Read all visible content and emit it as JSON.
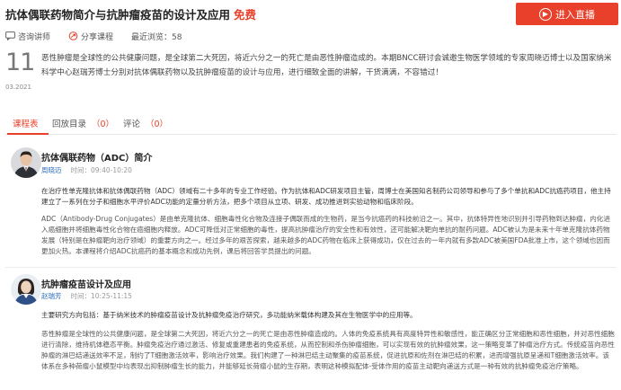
{
  "header": {
    "title": "抗体偶联药物简介与抗肿瘤疫苗的设计及应用",
    "free_label": "免费",
    "live_button": "进入直播"
  },
  "meta": {
    "consult": "咨询讲师",
    "share": "分享课程",
    "views": "最近浏览：58"
  },
  "date": {
    "day": "11",
    "month_year": "03.2021"
  },
  "intro": "恶性肿瘤是全球性的公共健康问题，是全球第二大死因，将近六分之一的死亡是由恶性肿瘤造成的。本期BNCC研讨会诚邀生物医学领域的专家周晓迈博士以及国家纳米科学中心赵瑞芳博士分别对抗体偶联药物以及抗肿瘤疫苗的设计与应用，进行细致全面的讲解，干货满满，不容错过！",
  "tabs": [
    {
      "label": "课程表",
      "count": ""
    },
    {
      "label": "回放目录",
      "count": "（0）"
    },
    {
      "label": "评论",
      "count": "（0）"
    }
  ],
  "courses": [
    {
      "title": "抗体偶联药物（ADC）简介",
      "speaker": "周晓迈",
      "time": "时间：09:40-10:20",
      "paragraphs": [
        "在治疗性单克隆抗体和抗体偶联药物（ADC）领域有二十多年的专业工作经验。作为抗体和ADC研发项目主管，周博士在美国知名制药公司领导和参与了多个单抗和ADC抗癌药项目，他主持建立了一系列在分子和细胞水平评价ADC功能的定量分析方法，把多个项目从立项、研发、成功推进到实验动物和临床阶段。",
        "ADC（Antibody-Drug Conjugates）是由单克隆抗体、细胞毒性化合物及连接子偶联而成的生物药，是当今抗癌药的科技前沿之一。其中，抗体特异性地识别并引导药物到达肿瘤，内化进入癌细胞并将细胞毒性化合物在癌细胞内释放。ADC可降低对正常细胞的毒性，提高抗肿瘤治疗的安全性和有效性，还可能解决靶向单抗的耐药问题。ADC被认为是未来十年单克隆抗体药物发展（特别是在肿瘤靶向治疗领域）的重要方向之一。经过多年的艰苦探索，越来越多的ADC药物在临床上获得成功，仅在过去的一年内就有多款ADC被美国FDA批准上市，这个领域也因而更加火热。本课程将介绍ADC抗癌药的基本概念和成功先例，课后将回答学员提出的问题。"
      ]
    },
    {
      "title": "抗肿瘤疫苗设计及应用",
      "speaker": "赵瑞芳",
      "time": "时间：10:25-11:15",
      "paragraphs": [
        "主要研究方向包括：基于纳米技术的肿瘤疫苗设计及抗肿瘤免疫治疗研究，多功能纳米载体构建及其在生物医学中的应用等。",
        "恶性肿瘤是全球性的公共健康问题，是全球第二大死因，将近六分之一的死亡是由恶性肿瘤造成的。人体的免疫系统具有高度特异性和敏感性，能正确区分正常细胞和恶性细胞，并对恶性细胞进行清除，维持机体稳态平衡。肿瘤免疫治疗通过激活、修复或重建患者的免疫系统，从而控制和杀伤肿瘤细胞，可以实现有效的抗肿瘤效果，这一策略变革了肿瘤治疗方式。传统疫苗向恶性肿瘤的淋巴结递送效率不足，制约了T细胞激活效率，影响治疗效果。我们构建了一种淋巴结主动聚集的疫苗系统，促进抗原和佐剂在淋巴结的积累，进而增强抗原呈递和T细胞激活效率。该体系在多种荷瘤小鼠模型中均表现出抑制肿瘤生长的能力，并能够延长荷瘤小鼠的生存期，表明这种模拟配体-受体作用的疫苗主动靶向递送方式是一种有效的抗肿瘤免疫治疗策略。"
      ]
    }
  ],
  "colors": {
    "accent": "#e8402a",
    "link": "#2d6fbf"
  }
}
